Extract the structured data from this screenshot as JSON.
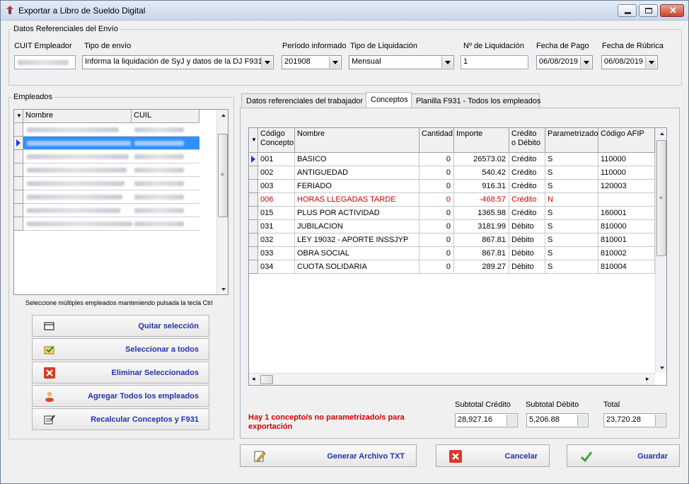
{
  "window": {
    "title": "Exportar a Libro de Sueldo Digital"
  },
  "ref": {
    "legend": "Datos Referenciales del Envío",
    "cuit_label": "CUIT Empleador",
    "tipo_envio_label": "Tipo de envío",
    "tipo_envio_value": "Informa la liquidación de SyJ y datos de la DJ F931",
    "periodo_label": "Período informado",
    "periodo_value": "201908",
    "tipo_liq_label": "Tipo de Liquidación",
    "tipo_liq_value": "Mensual",
    "nro_liq_label": "Nº de Liquidación",
    "nro_liq_value": "1",
    "fecha_pago_label": "Fecha de Pago",
    "fecha_pago_value": "06/08/2019",
    "fecha_rubrica_label": "Fecha de Rúbrica",
    "fecha_rubrica_value": "06/08/2019"
  },
  "empleados": {
    "legend": "Empleados",
    "col_nombre": "Nombre",
    "col_cuil": "CUIL",
    "row_count": 8,
    "selected_row": 1,
    "hint": "Seleccione múltiples empleados manteniendo pulsada la tecla Ctrl"
  },
  "actions": {
    "quitar": "Quitar selección",
    "seleccionar": "Seleccionar a todos",
    "eliminar": "Eliminar Seleccionados",
    "agregar": "Agregar Todos los empleados",
    "recalcular": "Recalcular Conceptos y F931"
  },
  "tabs": [
    {
      "label": "Datos referenciales del trabajador"
    },
    {
      "label": "Conceptos"
    },
    {
      "label": "Planilla F931 - Todos los empleados"
    }
  ],
  "conceptos": {
    "headers": {
      "codigo": "Código Concepto",
      "nombre": "Nombre",
      "cantidad": "Cantidad",
      "importe": "Importe",
      "credito": "Crédito o Débito",
      "param": "Parametrizado",
      "afip": "Código AFIP"
    },
    "rows": [
      {
        "codigo": "001",
        "nombre": "BASICO",
        "cantidad": "0",
        "importe": "26573.02",
        "tipo": "Crédito",
        "param": "S",
        "afip": "110000",
        "warn": false
      },
      {
        "codigo": "002",
        "nombre": "ANTIGUEDAD",
        "cantidad": "0",
        "importe": "540.42",
        "tipo": "Crédito",
        "param": "S",
        "afip": "110000",
        "warn": false
      },
      {
        "codigo": "003",
        "nombre": "FERIADO",
        "cantidad": "0",
        "importe": "916.31",
        "tipo": "Crédito",
        "param": "S",
        "afip": "120003",
        "warn": false
      },
      {
        "codigo": "006",
        "nombre": "HORAS LLEGADAS TARDE",
        "cantidad": "0",
        "importe": "-468.57",
        "tipo": "Crédito",
        "param": "N",
        "afip": "",
        "warn": true
      },
      {
        "codigo": "015",
        "nombre": "PLUS POR ACTIVIDAD",
        "cantidad": "0",
        "importe": "1365.98",
        "tipo": "Crédito",
        "param": "S",
        "afip": "160001",
        "warn": false
      },
      {
        "codigo": "031",
        "nombre": "JUBILACION",
        "cantidad": "0",
        "importe": "3181.99",
        "tipo": "Débito",
        "param": "S",
        "afip": "810000",
        "warn": false
      },
      {
        "codigo": "032",
        "nombre": "LEY 19032 - APORTE INSSJYP",
        "cantidad": "0",
        "importe": "867.81",
        "tipo": "Débito",
        "param": "S",
        "afip": "810001",
        "warn": false
      },
      {
        "codigo": "033",
        "nombre": "OBRA SOCIAL",
        "cantidad": "0",
        "importe": "867.81",
        "tipo": "Débito",
        "param": "S",
        "afip": "810002",
        "warn": false
      },
      {
        "codigo": "034",
        "nombre": "CUOTA SOLIDARIA",
        "cantidad": "0",
        "importe": "289.27",
        "tipo": "Débito",
        "param": "S",
        "afip": "810004",
        "warn": false
      }
    ]
  },
  "totals": {
    "warning": "Hay 1 concepto/s no parametrizado/s para exportación",
    "credito_label": "Subtotal Crédito",
    "credito_value": "28,927.16",
    "debito_label": "Subtotal Débito",
    "debito_value": "5,206.88",
    "total_label": "Total",
    "total_value": "23,720.28"
  },
  "footer": {
    "generar": "Generar Archivo TXT",
    "cancelar": "Cancelar",
    "guardar": "Guardar"
  }
}
